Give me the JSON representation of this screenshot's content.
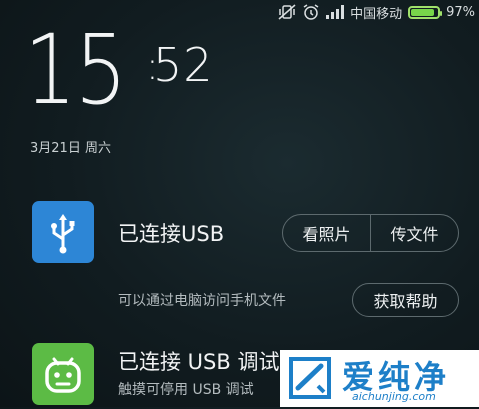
{
  "status_bar": {
    "carrier": "中国移动",
    "battery_percent": "97%",
    "battery_level": 0.97,
    "icons": [
      "vibrate-off-icon",
      "alarm-icon",
      "signal-icon",
      "battery-icon"
    ]
  },
  "lockscreen": {
    "hour": "15",
    "minute": "52",
    "date": "3月21日 周六"
  },
  "notifications": [
    {
      "icon": "usb-icon",
      "title": "已连接USB",
      "actions": [
        "看照片",
        "传文件"
      ],
      "subtitle": "可以通过电脑访问手机文件",
      "help_label": "获取帮助"
    },
    {
      "icon": "android-icon",
      "title": "已连接 USB 调试",
      "subtitle": "触摸可停用 USB 调试"
    }
  ],
  "watermark": {
    "chinese": "爱纯净",
    "url": "aichunjing.com"
  },
  "colors": {
    "usb_icon_bg": "#2d86d6",
    "android_icon_bg": "#5cbb45",
    "battery": "#78d64a",
    "watermark_blue": "#1d7fc8"
  }
}
